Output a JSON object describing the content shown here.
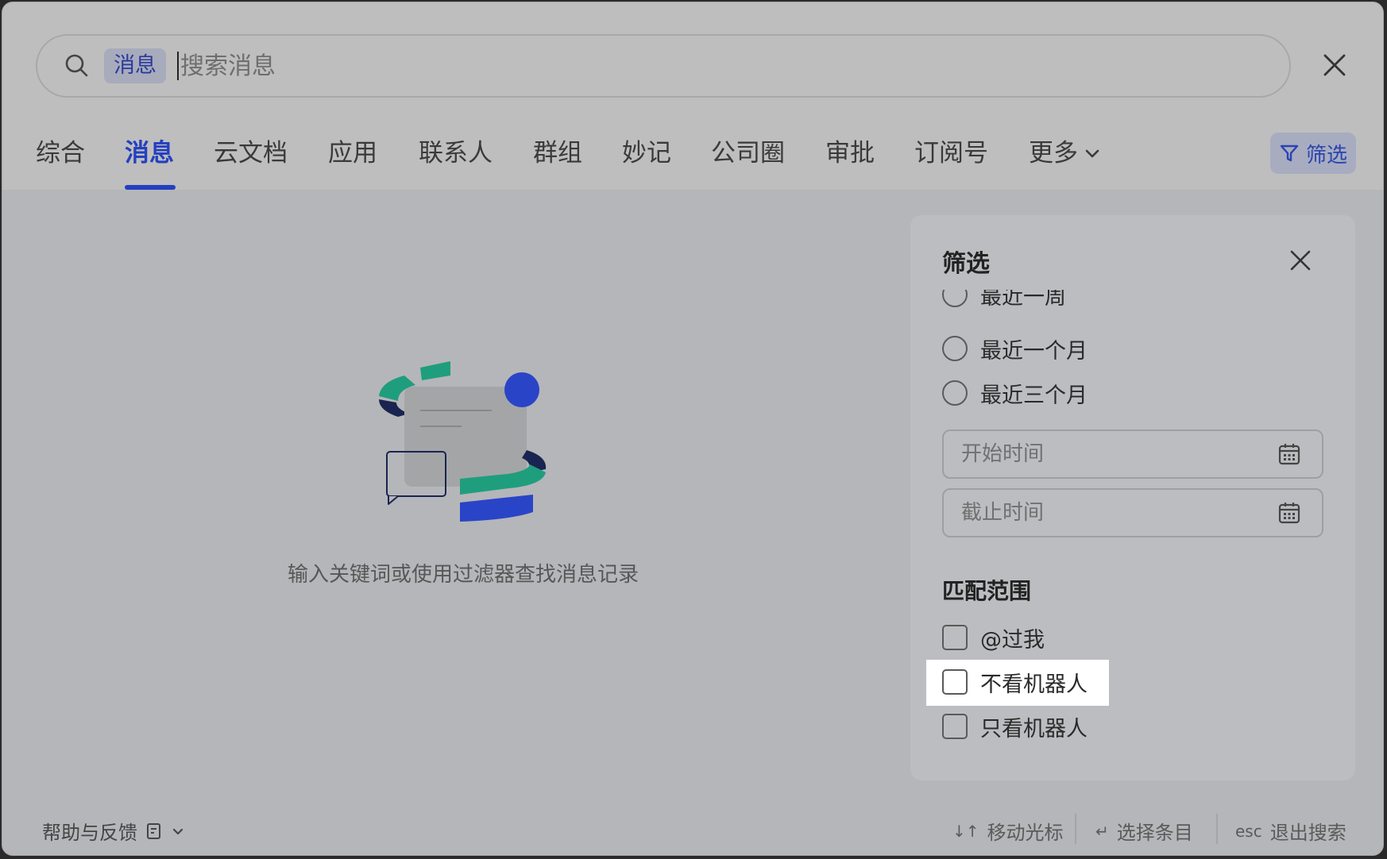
{
  "search": {
    "scope_tag": "消息",
    "placeholder": "搜索消息"
  },
  "tabs": [
    {
      "label": "综合",
      "active": false
    },
    {
      "label": "消息",
      "active": true
    },
    {
      "label": "云文档",
      "active": false
    },
    {
      "label": "应用",
      "active": false
    },
    {
      "label": "联系人",
      "active": false
    },
    {
      "label": "群组",
      "active": false
    },
    {
      "label": "妙记",
      "active": false
    },
    {
      "label": "公司圈",
      "active": false
    },
    {
      "label": "审批",
      "active": false
    },
    {
      "label": "订阅号",
      "active": false
    },
    {
      "label": "更多",
      "active": false
    }
  ],
  "filter_button": {
    "label": "筛选",
    "icon": "funnel-icon"
  },
  "empty_state": {
    "text": "输入关键词或使用过滤器查找消息记录",
    "icon": "message-illustration"
  },
  "filter_panel": {
    "title": "筛选",
    "time_options": [
      {
        "label": "最近一周",
        "selected": false
      },
      {
        "label": "最近一个月",
        "selected": false
      },
      {
        "label": "最近三个月",
        "selected": false
      }
    ],
    "start_date_placeholder": "开始时间",
    "end_date_placeholder": "截止时间",
    "match_scope": {
      "title": "匹配范围",
      "options": [
        {
          "label": "@过我",
          "checked": false
        },
        {
          "label": "不看机器人",
          "checked": false,
          "highlighted": true
        },
        {
          "label": "只看机器人",
          "checked": false
        }
      ]
    }
  },
  "footer": {
    "help_label": "帮助与反馈",
    "shortcuts": [
      {
        "key": "↓↑",
        "label": "移动光标"
      },
      {
        "key": "↵",
        "label": "选择条目"
      },
      {
        "key": "esc",
        "label": "退出搜索"
      }
    ]
  },
  "colors": {
    "accent": "#2440C0",
    "illustration_green": "#1F9E7E",
    "illustration_navy": "#1A2450",
    "illustration_blue": "#2A44C8",
    "highlight": "#FFFFFF"
  }
}
